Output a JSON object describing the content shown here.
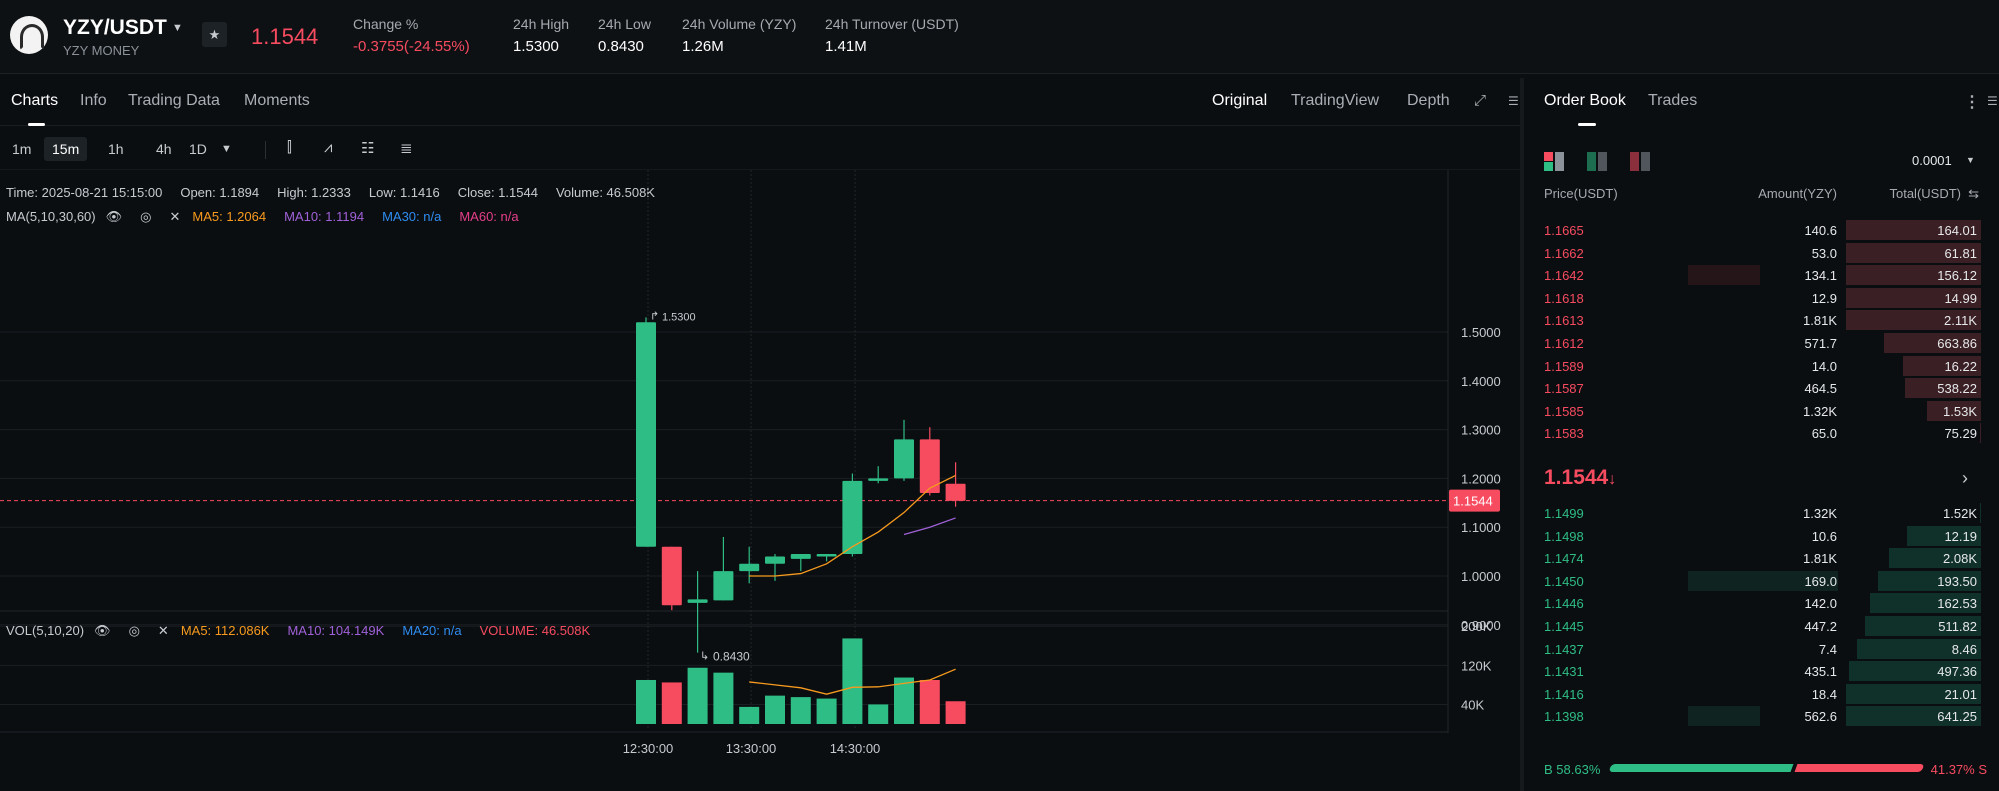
{
  "header": {
    "pair": "YZY/USDT",
    "pair_sub": "YZY MONEY",
    "last_price": "1.1544",
    "stats": [
      {
        "label": "Change %",
        "value": "-0.3755(-24.55%)"
      },
      {
        "label": "24h High",
        "value": "1.5300"
      },
      {
        "label": "24h Low",
        "value": "0.8430"
      },
      {
        "label": "24h Volume (YZY)",
        "value": "1.26M"
      },
      {
        "label": "24h Turnover (USDT)",
        "value": "1.41M"
      }
    ]
  },
  "chart_tabs": [
    "Charts",
    "Info",
    "Trading Data",
    "Moments"
  ],
  "view_tabs": [
    "Original",
    "TradingView",
    "Depth"
  ],
  "timeframes": [
    "1m",
    "15m",
    "1h",
    "4h",
    "1D"
  ],
  "info": {
    "time": "Time: 2025-08-21 15:15:00",
    "open": "Open: 1.1894",
    "high": "High: 1.2333",
    "low": "Low: 1.1416",
    "close": "Close: 1.1544",
    "volume": "Volume: 46.508K",
    "ma_label": "MA(5,10,30,60)",
    "ma5": "MA5: 1.2064",
    "ma10": "MA10: 1.1194",
    "ma30": "MA30: n/a",
    "ma60": "MA60: n/a"
  },
  "vol_info": {
    "label": "VOL(5,10,20)",
    "ma5": "MA5: 112.086K",
    "ma10": "MA10: 104.149K",
    "ma20": "MA20: n/a",
    "volume": "VOLUME: 46.508K"
  },
  "colors": {
    "up": "#2ebd85",
    "down": "#f74b60",
    "ma5": "#f79a1e",
    "ma10": "#a061d8"
  },
  "chart_data": {
    "type": "candlestick",
    "price_ticks": [
      "1.5000",
      "1.4000",
      "1.3000",
      "1.2000",
      "1.1000",
      "1.0000",
      "0.9000"
    ],
    "price_values": [
      1.5,
      1.4,
      1.3,
      1.2,
      1.1,
      1.0,
      0.9
    ],
    "ylim": [
      0.8,
      1.6
    ],
    "last_price_label": "1.1544",
    "high_label": "1.5300",
    "low_label": "0.8430",
    "x_ticks": [
      "12:30:00",
      "13:30:00",
      "14:30:00"
    ],
    "vol_ticks": [
      "200K",
      "120K",
      "40K"
    ],
    "vol_values": [
      200000,
      120000,
      40000
    ],
    "candles": [
      {
        "o": 1.06,
        "h": 1.53,
        "l": 1.06,
        "c": 1.52,
        "v": 90000
      },
      {
        "o": 1.06,
        "h": 1.06,
        "l": 0.93,
        "c": 0.94,
        "v": 85000
      },
      {
        "o": 0.945,
        "h": 1.01,
        "l": 0.843,
        "c": 0.952,
        "v": 115000
      },
      {
        "o": 0.95,
        "h": 1.08,
        "l": 0.95,
        "c": 1.01,
        "v": 105000
      },
      {
        "o": 1.01,
        "h": 1.06,
        "l": 0.985,
        "c": 1.025,
        "v": 35000
      },
      {
        "o": 1.025,
        "h": 1.045,
        "l": 0.99,
        "c": 1.04,
        "v": 58000
      },
      {
        "o": 1.035,
        "h": 1.04,
        "l": 1.01,
        "c": 1.045,
        "v": 55000
      },
      {
        "o": 1.04,
        "h": 1.045,
        "l": 1.03,
        "c": 1.045,
        "v": 52000
      },
      {
        "o": 1.045,
        "h": 1.21,
        "l": 1.04,
        "c": 1.195,
        "v": 175000
      },
      {
        "o": 1.195,
        "h": 1.225,
        "l": 1.19,
        "c": 1.2,
        "v": 40000
      },
      {
        "o": 1.2,
        "h": 1.32,
        "l": 1.195,
        "c": 1.28,
        "v": 95000
      },
      {
        "o": 1.28,
        "h": 1.305,
        "l": 1.165,
        "c": 1.17,
        "v": 90000
      },
      {
        "o": 1.189,
        "h": 1.233,
        "l": 1.142,
        "c": 1.154,
        "v": 46508
      }
    ],
    "ma5": [
      null,
      null,
      null,
      null,
      1.0,
      1.0,
      1.005,
      1.025,
      1.06,
      1.09,
      1.13,
      1.18,
      1.206
    ],
    "ma10": [
      null,
      null,
      null,
      null,
      null,
      null,
      null,
      null,
      null,
      null,
      1.085,
      1.1,
      1.119
    ],
    "vol_ma5": [
      null,
      null,
      null,
      null,
      86000,
      80000,
      74000,
      61000,
      75000,
      76000,
      83000,
      90000,
      112086
    ]
  },
  "book": {
    "tabs": [
      "Order Book",
      "Trades"
    ],
    "tick_size": "0.0001",
    "headers": [
      "Price(USDT)",
      "Amount(YZY)",
      "Total(USDT)"
    ],
    "asks": [
      {
        "price": "1.1665",
        "amount": "140.6",
        "total": "164.01",
        "depth": 1.0,
        "amt_frac": 0.0
      },
      {
        "price": "1.1662",
        "amount": "53.0",
        "total": "61.81",
        "depth": 1.0,
        "amt_frac": 0.0
      },
      {
        "price": "1.1642",
        "amount": "134.1",
        "total": "156.12",
        "depth": 1.0,
        "amt_frac": 0.48
      },
      {
        "price": "1.1618",
        "amount": "12.9",
        "total": "14.99",
        "depth": 1.0,
        "amt_frac": 0.0
      },
      {
        "price": "1.1613",
        "amount": "1.81K",
        "total": "2.11K",
        "depth": 1.0,
        "amt_frac": 0.0
      },
      {
        "price": "1.1612",
        "amount": "571.7",
        "total": "663.86",
        "depth": 0.72,
        "amt_frac": 0.0
      },
      {
        "price": "1.1589",
        "amount": "14.0",
        "total": "16.22",
        "depth": 0.58,
        "amt_frac": 0.0
      },
      {
        "price": "1.1587",
        "amount": "464.5",
        "total": "538.22",
        "depth": 0.56,
        "amt_frac": 0.0
      },
      {
        "price": "1.1585",
        "amount": "1.32K",
        "total": "1.53K",
        "depth": 0.4,
        "amt_frac": 0.0
      },
      {
        "price": "1.1583",
        "amount": "65.0",
        "total": "75.29",
        "depth": 0.01,
        "amt_frac": 0.0
      }
    ],
    "mid": "1.1544",
    "mid_arrow": "↓",
    "bids": [
      {
        "price": "1.1499",
        "amount": "1.32K",
        "total": "1.52K",
        "depth": 0.01,
        "amt_frac": 0.0
      },
      {
        "price": "1.1498",
        "amount": "10.6",
        "total": "12.19",
        "depth": 0.55,
        "amt_frac": 0.0
      },
      {
        "price": "1.1474",
        "amount": "1.81K",
        "total": "2.08K",
        "depth": 0.68,
        "amt_frac": 0.0
      },
      {
        "price": "1.1450",
        "amount": "169.0",
        "total": "193.50",
        "depth": 0.76,
        "amt_frac": 1.0
      },
      {
        "price": "1.1446",
        "amount": "142.0",
        "total": "162.53",
        "depth": 0.82,
        "amt_frac": 0.0
      },
      {
        "price": "1.1445",
        "amount": "447.2",
        "total": "511.82",
        "depth": 0.86,
        "amt_frac": 0.0
      },
      {
        "price": "1.1437",
        "amount": "7.4",
        "total": "8.46",
        "depth": 0.92,
        "amt_frac": 0.0
      },
      {
        "price": "1.1431",
        "amount": "435.1",
        "total": "497.36",
        "depth": 0.98,
        "amt_frac": 0.0
      },
      {
        "price": "1.1416",
        "amount": "18.4",
        "total": "21.01",
        "depth": 1.0,
        "amt_frac": 0.0
      },
      {
        "price": "1.1398",
        "amount": "562.6",
        "total": "641.25",
        "depth": 1.0,
        "amt_frac": 0.48
      }
    ],
    "buy_ratio": "B 58.63%",
    "sell_ratio": "41.37% S",
    "buy_frac": 0.5863
  }
}
